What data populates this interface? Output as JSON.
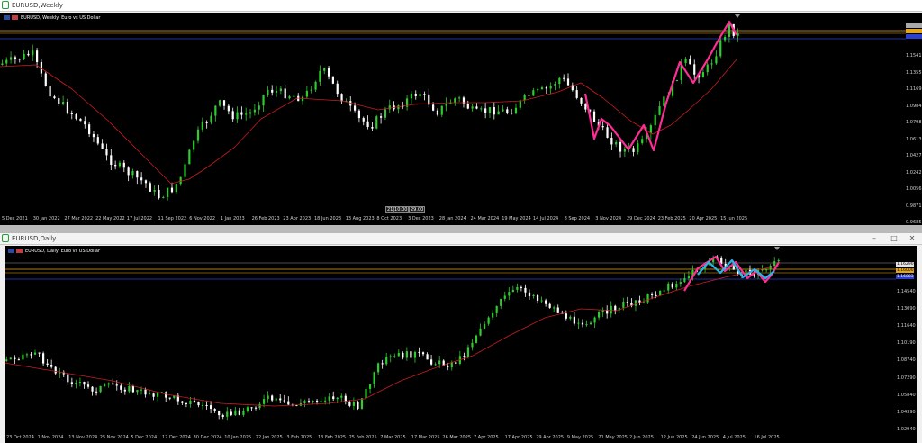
{
  "colors": {
    "bull": "#2ecc2e",
    "bear": "#ffffff",
    "ma": "#c81e1e",
    "pattern_pink": "#ff2d95",
    "pattern_cyan": "#2ab4e8",
    "level_orange": "#e5a51a",
    "level_blue": "#2b3fd1"
  },
  "icons": {
    "app": "chart-window-icon",
    "minimize": "minimize-icon",
    "maximize": "maximize-icon",
    "close": "close-icon"
  },
  "weekly": {
    "window_title": "EURUSD,Weekly",
    "label": "EURUSD, Weekly: Euro vs US Dollar",
    "y_ticks": [
      "1.1541",
      "1.1355",
      "1.1169",
      "1.0984",
      "1.0798",
      "1.0613",
      "1.0427",
      "1.0242",
      "1.0056",
      "0.9871",
      "0.9685"
    ],
    "x_ticks": [
      "5 Dec 2021",
      "30 Jan 2022",
      "27 Mar 2022",
      "22 May 2022",
      "17 Jul 2022",
      "11 Sep 2022",
      "6 Nov 2022",
      "1 Jan 2023",
      "26 Feb 2023",
      "23 Apr 2023",
      "18 Jun 2023",
      "13 Aug 2023",
      "8 Oct 2023",
      "3 Dec 2023",
      "28 Jan 2024",
      "24 Mar 2024",
      "19 May 2024",
      "14 Jul 2024",
      "8 Sep 2024",
      "3 Nov 2024",
      "29 Dec 2024",
      "23 Feb 2025",
      "20 Apr 2025",
      "15 Jun 2025"
    ],
    "crosshair_tags": [
      "21|10:00",
      "29.00"
    ]
  },
  "daily": {
    "window_title": "EURUSD,Daily",
    "label": "EURUSD, Daily: Euro vs US Dollar",
    "price_boxes": [
      "1.16290",
      "1.16000",
      "1.16883"
    ],
    "y_ticks": [
      "1.14540",
      "1.13090",
      "1.11640",
      "1.10190",
      "1.08740",
      "1.07290",
      "1.05840",
      "1.04390",
      "1.02940"
    ],
    "x_ticks": [
      "23 Oct 2024",
      "1 Nov 2024",
      "13 Nov 2024",
      "25 Nov 2024",
      "5 Dec 2024",
      "17 Dec 2024",
      "30 Dec 2024",
      "10 Jan 2025",
      "22 Jan 2025",
      "3 Feb 2025",
      "13 Feb 2025",
      "25 Feb 2025",
      "7 Mar 2025",
      "17 Mar 2025",
      "26 Mar 2025",
      "7 Apr 2025",
      "17 Apr 2025",
      "29 Apr 2025",
      "9 May 2025",
      "21 May 2025",
      "2 Jun 2025",
      "12 Jun 2025",
      "24 Jun 2025",
      "4 Jul 2025",
      "16 Jul 2025"
    ]
  }
}
